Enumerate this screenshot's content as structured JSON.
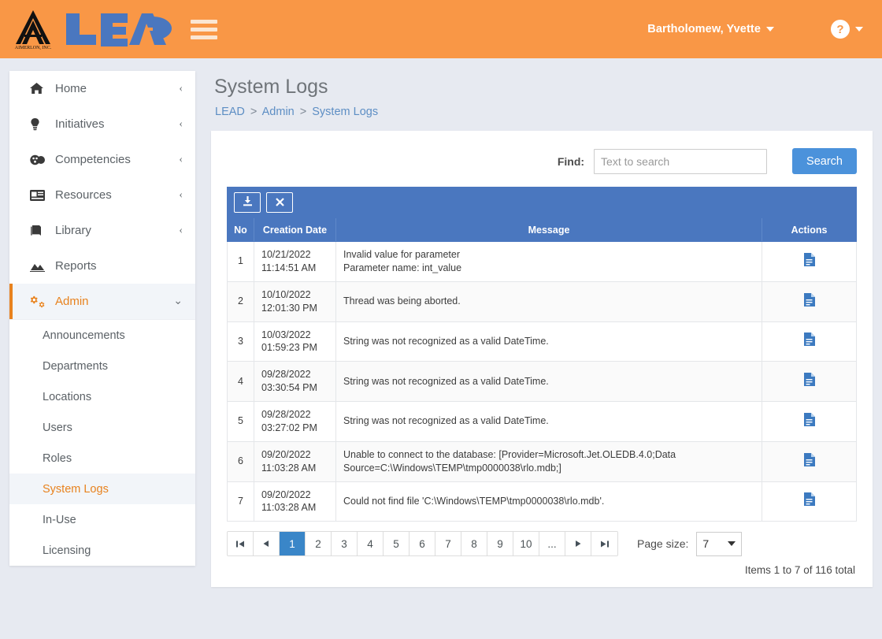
{
  "header": {
    "logo_company": "AIMERLON, INC.",
    "logo_word": "LEAD",
    "menu_icon": "hamburger-icon",
    "user_name": "Bartholomew, Yvette",
    "help_glyph": "?"
  },
  "sidebar": {
    "items": [
      {
        "label": "Home",
        "icon": "home-icon",
        "chevron": "‹",
        "active": false
      },
      {
        "label": "Initiatives",
        "icon": "lightbulb-icon",
        "chevron": "‹",
        "active": false
      },
      {
        "label": "Competencies",
        "icon": "medal-icon",
        "chevron": "‹",
        "active": false
      },
      {
        "label": "Resources",
        "icon": "newspaper-icon",
        "chevron": "‹",
        "active": false
      },
      {
        "label": "Library",
        "icon": "book-icon",
        "chevron": "‹",
        "active": false
      },
      {
        "label": "Reports",
        "icon": "chart-area-icon",
        "chevron": "",
        "active": false
      },
      {
        "label": "Admin",
        "icon": "gears-icon",
        "chevron": "⌄",
        "active": true
      }
    ],
    "subitems": [
      {
        "label": "Announcements",
        "active": false
      },
      {
        "label": "Departments",
        "active": false
      },
      {
        "label": "Locations",
        "active": false
      },
      {
        "label": "Users",
        "active": false
      },
      {
        "label": "Roles",
        "active": false
      },
      {
        "label": "System Logs",
        "active": true
      },
      {
        "label": "In-Use",
        "active": false
      },
      {
        "label": "Licensing",
        "active": false
      }
    ]
  },
  "page": {
    "title": "System Logs",
    "breadcrumb": [
      "LEAD",
      "Admin",
      "System Logs"
    ],
    "breadcrumb_separator": ">"
  },
  "search": {
    "label": "Find:",
    "placeholder": "Text to search",
    "value": "",
    "button_label": "Search"
  },
  "toolbar": {
    "export_icon": "download-icon",
    "clear_icon": "close-x-icon"
  },
  "table": {
    "columns": [
      "No",
      "Creation Date",
      "Message",
      "Actions"
    ],
    "rows": [
      {
        "no": "1",
        "date": "10/21/2022\n11:14:51 AM",
        "message": "Invalid value for parameter\nParameter name: int_value",
        "action_icon": "document-icon"
      },
      {
        "no": "2",
        "date": "10/10/2022\n12:01:30 PM",
        "message": "Thread was being aborted.",
        "action_icon": "document-icon"
      },
      {
        "no": "3",
        "date": "10/03/2022\n01:59:23 PM",
        "message": "String was not recognized as a valid DateTime.",
        "action_icon": "document-icon"
      },
      {
        "no": "4",
        "date": "09/28/2022\n03:30:54 PM",
        "message": "String was not recognized as a valid DateTime.",
        "action_icon": "document-icon"
      },
      {
        "no": "5",
        "date": "09/28/2022\n03:27:02 PM",
        "message": "String was not recognized as a valid DateTime.",
        "action_icon": "document-icon"
      },
      {
        "no": "6",
        "date": "09/20/2022\n11:03:28 AM",
        "message": "Unable to connect to the database: [Provider=Microsoft.Jet.OLEDB.4.0;Data Source=C:\\Windows\\TEMP\\tmp0000038\\rlo.mdb;]",
        "action_icon": "document-icon"
      },
      {
        "no": "7",
        "date": "09/20/2022\n11:03:28 AM",
        "message": "Could not find file 'C:\\Windows\\TEMP\\tmp0000038\\rlo.mdb'.",
        "action_icon": "document-icon"
      }
    ]
  },
  "pagination": {
    "first_glyph": "⏮",
    "prev_glyph": "◀",
    "next_glyph": "▶",
    "last_glyph": "⏭",
    "pages": [
      "1",
      "2",
      "3",
      "4",
      "5",
      "6",
      "7",
      "8",
      "9",
      "10",
      "..."
    ],
    "current_page": "1",
    "page_size_label": "Page size:",
    "page_size_value": "7",
    "items_total": "Items 1 to 7 of 116 total"
  },
  "colors": {
    "header_orange": "#f99746",
    "accent_orange": "#e8821e",
    "grid_blue": "#4a77bf",
    "button_blue": "#4b92db",
    "page_bg": "#e7eaf1"
  }
}
